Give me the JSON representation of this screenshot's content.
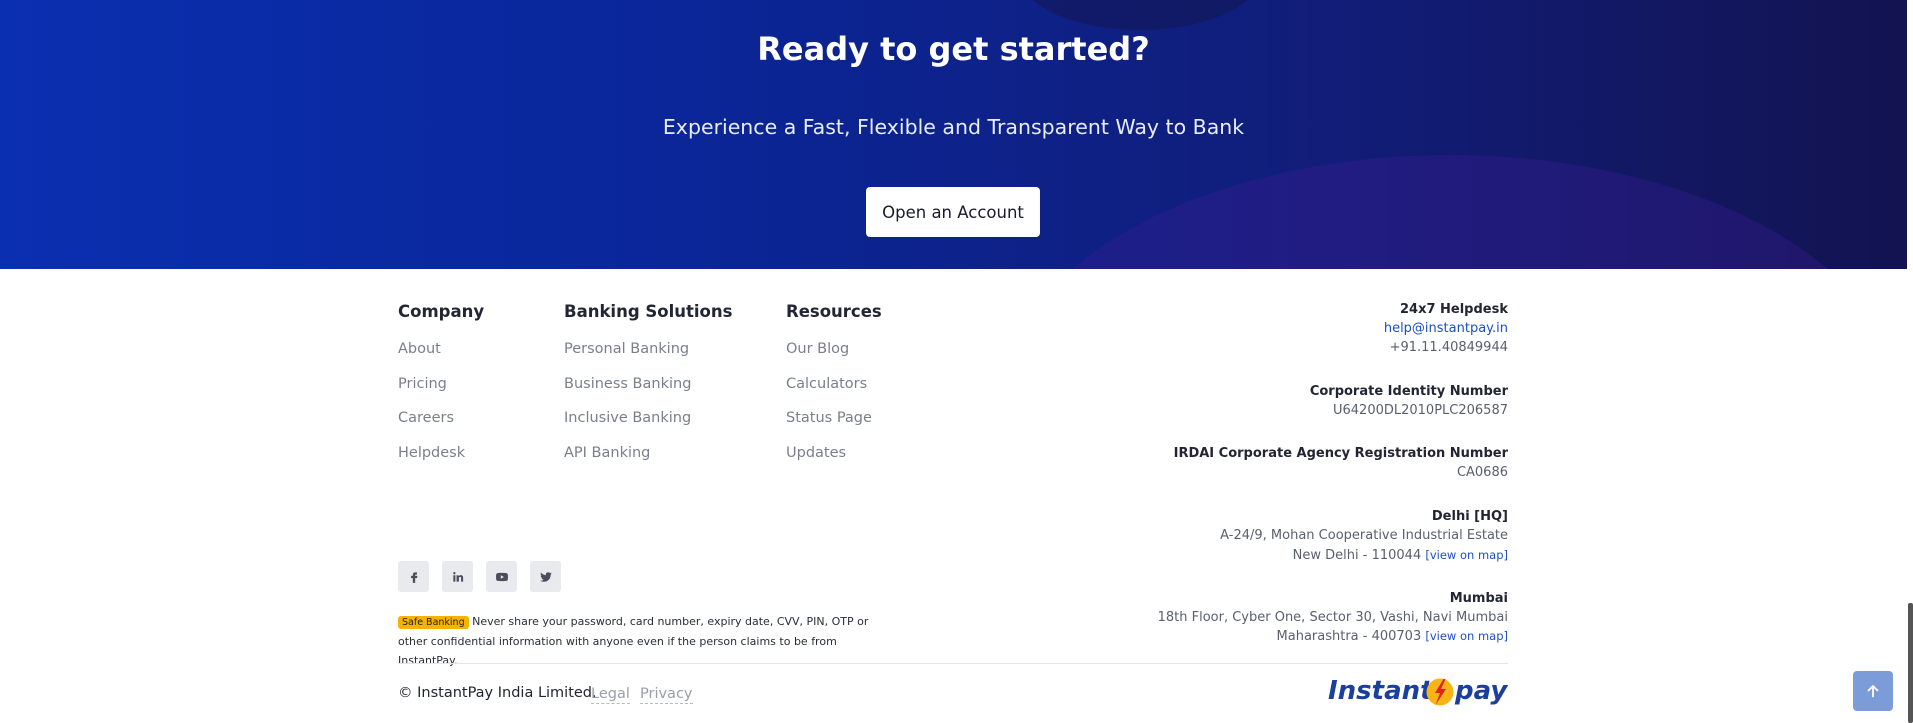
{
  "hero": {
    "title": "Ready to get started?",
    "subtitle": "Experience a Fast, Flexible and Transparent Way to Bank",
    "cta": "Open an Account"
  },
  "columns": [
    {
      "title": "Company",
      "links": [
        "About",
        "Pricing",
        "Careers",
        "Helpdesk"
      ]
    },
    {
      "title": "Banking Solutions",
      "links": [
        "Personal Banking",
        "Business Banking",
        "Inclusive Banking",
        "API Banking"
      ]
    },
    {
      "title": "Resources",
      "links": [
        "Our Blog",
        "Calculators",
        "Status Page",
        "Updates"
      ]
    }
  ],
  "contact": {
    "helpdesk_title": "24x7 Helpdesk",
    "email": "help@instantpay.in",
    "phone": "+91.11.40849944",
    "cin_title": "Corporate Identity Number",
    "cin": "U64200DL2010PLC206587",
    "irdai_title": "IRDAI Corporate Agency Registration Number",
    "irdai": "CA0686",
    "delhi_title": "Delhi [HQ]",
    "delhi_line1": "A-24/9, Mohan Cooperative Industrial Estate",
    "delhi_line2": "New Delhi - 110044",
    "mumbai_title": "Mumbai",
    "mumbai_line1": "18th Floor, Cyber One, Sector 30, Vashi, Navi Mumbai",
    "mumbai_line2": "Maharashtra - 400703",
    "map_link": "[view on map]"
  },
  "social": [
    "facebook-icon",
    "linkedin-icon",
    "youtube-icon",
    "twitter-icon"
  ],
  "notice": {
    "badge": "Safe Banking",
    "text": "Never share your password, card number, expiry date, CVV, PIN, OTP or other confidential information with anyone even if the person claims to be from InstantPay."
  },
  "bottom": {
    "copyright": "© InstantPay India Limited.",
    "legal": "Legal",
    "privacy": "Privacy"
  },
  "logo": {
    "part1": "Instant",
    "part2": "pay"
  },
  "colors": {
    "hero_start": "#0a2fb0",
    "hero_end": "#121350",
    "link": "#1d4ec9",
    "badge": "#f5b300",
    "logo": "#1b3f9c",
    "top_button": "#7b9bd9"
  }
}
